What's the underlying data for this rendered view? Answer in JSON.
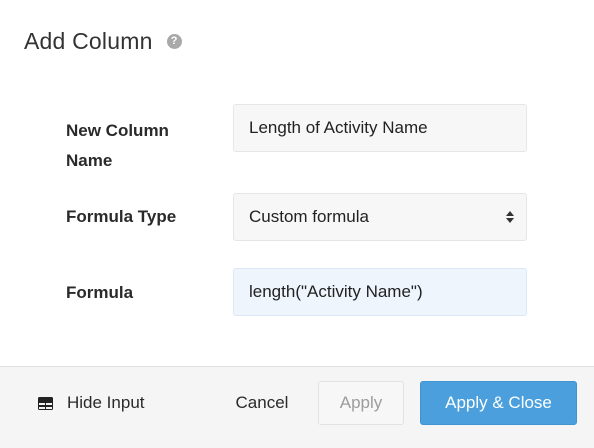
{
  "dialog": {
    "title": "Add Column",
    "help_icon": "question-circle-icon",
    "help_glyph": "?"
  },
  "form": {
    "new_column_name": {
      "label_line1": "New Column",
      "label_line2": "Name",
      "value": "Length of Activity Name"
    },
    "formula_type": {
      "label": "Formula Type",
      "selected": "Custom formula"
    },
    "formula": {
      "label": "Formula",
      "value": "length(\"Activity Name\")"
    }
  },
  "footer": {
    "hide_input_icon": "table-icon",
    "hide_input_label": "Hide Input",
    "cancel_label": "Cancel",
    "apply_label": "Apply",
    "apply_close_label": "Apply & Close"
  },
  "colors": {
    "primary_button": "#4a9fdc",
    "focused_field": "#eef5fc",
    "footer_bg": "#f5f5f5"
  }
}
